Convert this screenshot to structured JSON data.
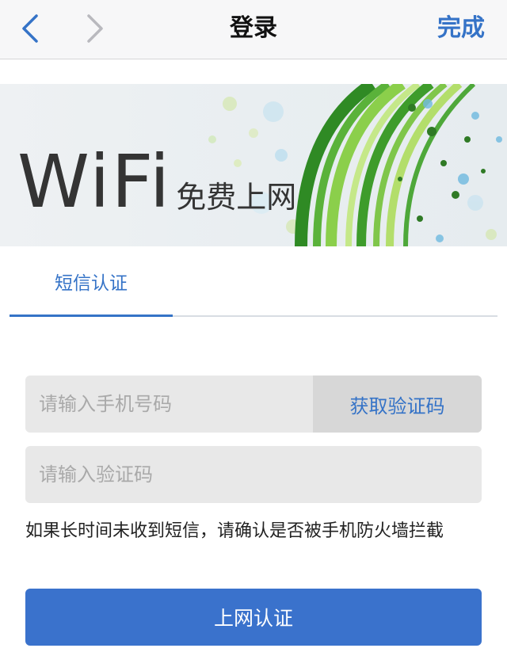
{
  "colors": {
    "accent": "#3573c7",
    "button_bg": "#3a72cc",
    "nav_bg": "#f7f7f8",
    "field_bg": "#e8e8e8"
  },
  "nav": {
    "back_icon": "chevron-left-icon",
    "forward_icon": "chevron-right-icon",
    "title": "登录",
    "done_label": "完成"
  },
  "banner": {
    "wifi_text": "WiFi",
    "free_text": "免费上网"
  },
  "tabs": [
    {
      "label": "短信认证",
      "active": true
    }
  ],
  "form": {
    "phone_placeholder": "请输入手机号码",
    "phone_value": "",
    "get_code_label": "获取验证码",
    "code_placeholder": "请输入验证码",
    "code_value": "",
    "hint": "如果长时间未收到短信，请确认是否被手机防火墙拦截",
    "submit_label": "上网认证"
  }
}
